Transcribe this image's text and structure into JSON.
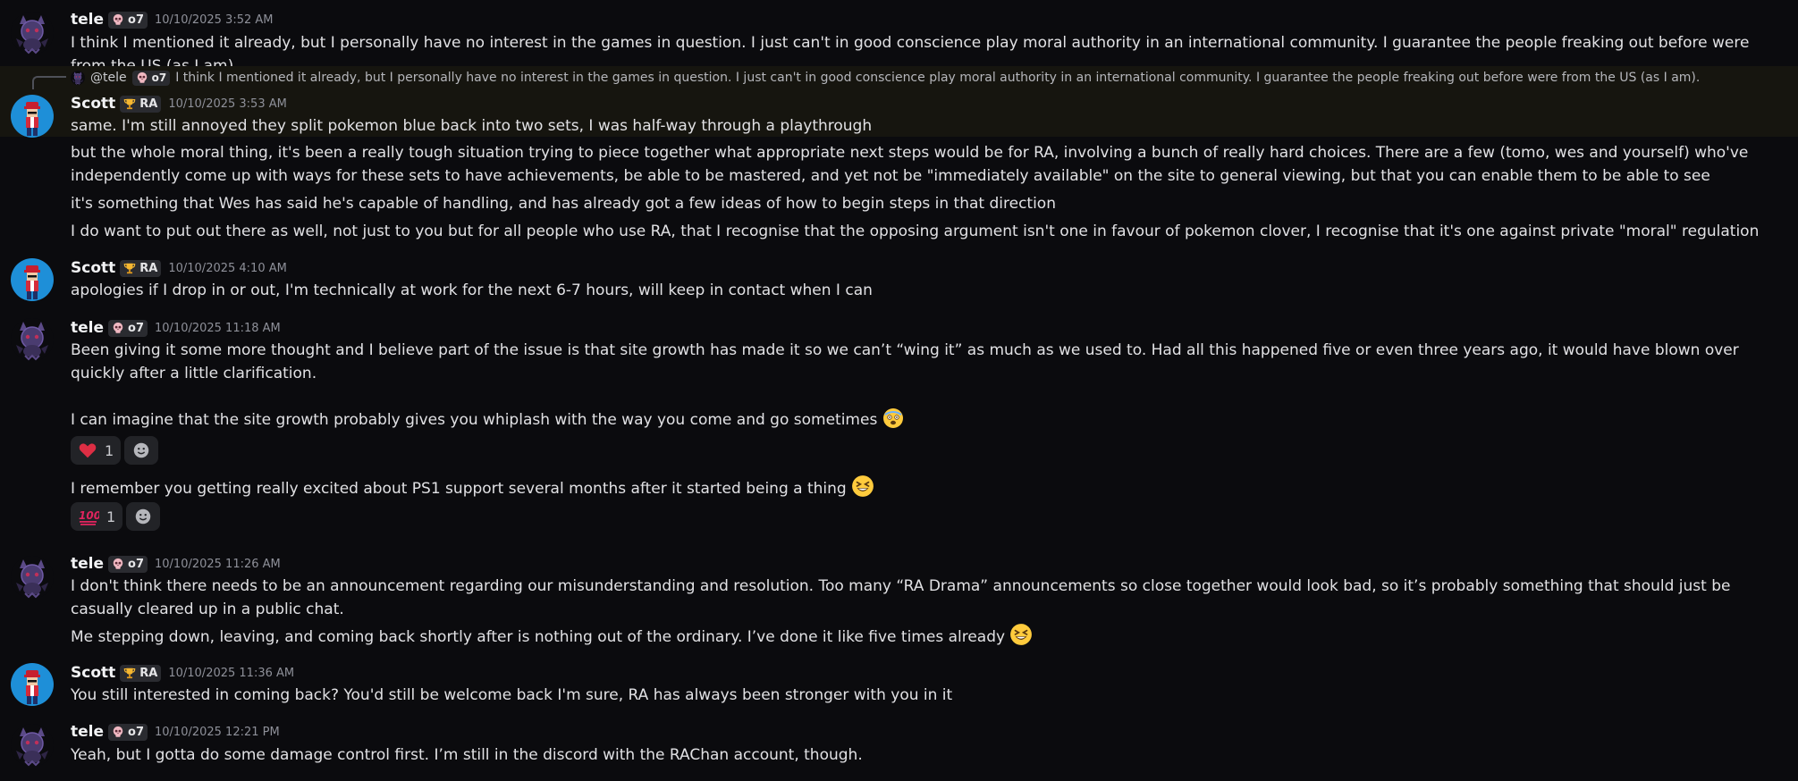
{
  "colors": {
    "background": "#0b0b0e",
    "reply_highlight": "#16150f",
    "username": "#f2f3f5",
    "timestamp": "#8e9099",
    "message_text": "#e1e1e4",
    "tag_bg": "#2a2b30"
  },
  "messages": [
    {
      "user": "tele",
      "tag_icon": "skull-icon",
      "tag": "o7",
      "time": "10/10/2025 3:52 AM",
      "lines": [
        "I think I mentioned it already, but I personally have no interest in the games in question. I just can't in good conscience play moral authority in an international community. I guarantee the people freaking out before were from the US (as I am)."
      ]
    },
    {
      "user": "Scott",
      "tag_icon": "trophy-icon",
      "tag": "RA",
      "time": "10/10/2025 3:53 AM",
      "reply": {
        "user": "@tele",
        "tag_icon": "skull-icon",
        "tag": "o7",
        "text": "I think I mentioned it already, but I personally have no interest in the games in question. I just can't in good conscience play moral authority in an international community. I guarantee the people freaking out before were from the US (as I am)."
      },
      "lines": [
        "same. I'm still annoyed they split pokemon blue back into two sets, I was half-way through a playthrough",
        "but the whole moral thing, it's been a really tough situation trying to piece together what appropriate next steps would be for RA, involving a bunch of really hard choices. There are a few (tomo, wes and yourself) who've independently come up with ways for these sets to have achievements, be able to be mastered, and yet not be \"immediately available\" on the site to general viewing, but that you can enable them to be able to see",
        "it's something that Wes has said he's capable of handling, and has already got a few ideas of how to begin steps in that direction",
        "I do want to put out there as well, not just to you but for all people who use RA, that I recognise that the opposing argument isn't one in favour of pokemon clover, I recognise that it's one against private \"moral\" regulation"
      ]
    },
    {
      "user": "Scott",
      "tag_icon": "trophy-icon",
      "tag": "RA",
      "time": "10/10/2025 4:10 AM",
      "lines": [
        "apologies if I drop in or out, I'm technically at work for the next 6-7 hours, will keep in contact when I can"
      ]
    },
    {
      "user": "tele",
      "tag_icon": "skull-icon",
      "tag": "o7",
      "time": "10/10/2025 11:18 AM",
      "lines": [
        "Been giving it some more thought and I believe part of the issue is that site growth has made it so we can’t “wing it” as much as we used to. Had all this happened five or even three years ago, it would have blown over quickly after a little clarification.",
        "I can imagine that the site growth probably gives you whiplash with the way you come and go sometimes",
        "I remember you getting really excited about PS1 support several months after it started being a thing"
      ],
      "emojis": [
        "dizzy-face-emoji",
        "grinning-squinting-emoji"
      ],
      "reactions": [
        {
          "icon": "red-heart-emoji",
          "count": "1"
        },
        {
          "icon": "hundred-points-emoji",
          "count": "1"
        }
      ],
      "add_reaction_icon": "add-reaction-icon"
    },
    {
      "user": "tele",
      "tag_icon": "skull-icon",
      "tag": "o7",
      "time": "10/10/2025 11:26 AM",
      "lines": [
        "I don't think there needs to be an announcement regarding our misunderstanding and resolution. Too many “RA Drama” announcements so close together would look bad, so it’s probably something that should just be casually cleared up in a public chat.",
        "Me stepping down, leaving, and coming back shortly after is nothing out of the ordinary. I’ve done it like five times already"
      ],
      "emojis": [
        "grinning-squinting-emoji"
      ]
    },
    {
      "user": "Scott",
      "tag_icon": "trophy-icon",
      "tag": "RA",
      "time": "10/10/2025 11:36 AM",
      "lines": [
        "You still interested in coming back? You'd still be welcome back I'm sure, RA has always been stronger with you in it"
      ]
    },
    {
      "user": "tele",
      "tag_icon": "skull-icon",
      "tag": "o7",
      "time": "10/10/2025 12:21 PM",
      "lines": [
        "Yeah, but I gotta do some damage control first. I’m still in the discord with the RAChan account, though."
      ]
    }
  ]
}
